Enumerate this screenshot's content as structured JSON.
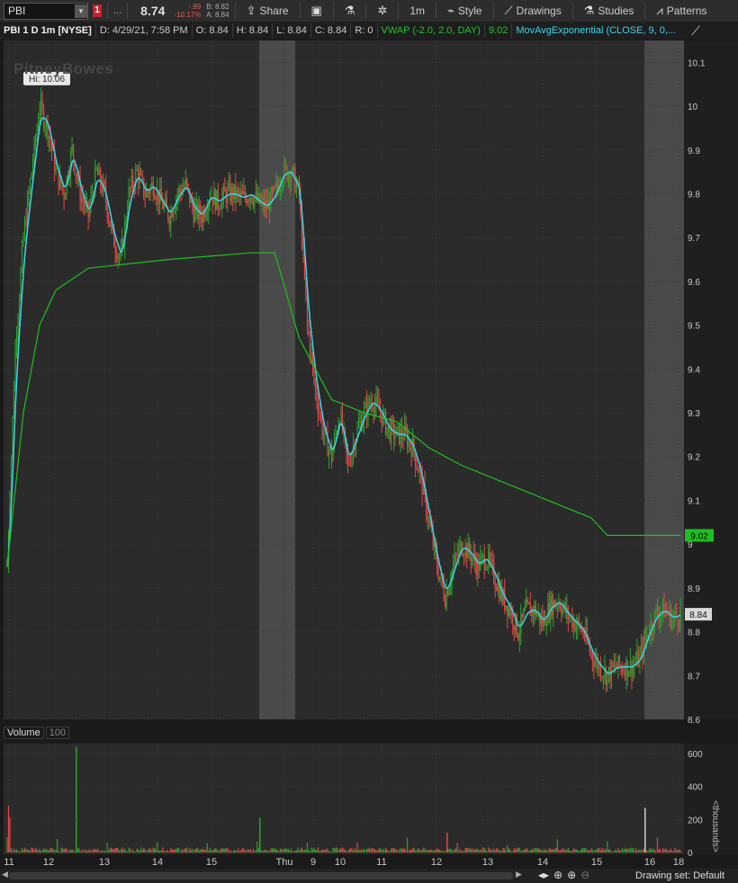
{
  "toolbar": {
    "symbol": "PBI",
    "alert_count": "1",
    "more": "...",
    "last": "8.74",
    "change": "-.99",
    "change_pct": "-10.17%",
    "bid": "B: 8.82",
    "ask": "A: 8.84",
    "share_label": "Share",
    "interval_label": "1m",
    "style_label": "Style",
    "drawings_label": "Drawings",
    "studies_label": "Studies",
    "patterns_label": "Patterns"
  },
  "info": {
    "title": "PBI 1 D 1m [NYSE]",
    "date": "D: 4/29/21, 7:58 PM",
    "open": "O: 8.84",
    "high": "H: 8.84",
    "low": "L: 8.84",
    "close": "C: 8.84",
    "range": "R: 0",
    "vwap_label": "VWAP (-2.0, 2.0, DAY)",
    "vwap_value": "9.02",
    "ema_label": "MovAvgExponential (CLOSE, 9, 0,..."
  },
  "watermark": "PitneyBowes",
  "volume": {
    "label": "Volume",
    "value": "100",
    "unit_label": "<thousands>"
  },
  "bottom": {
    "drawing_set": "Drawing set: Default"
  },
  "colors": {
    "up": "#2ea12e",
    "down": "#e04848",
    "vwap": "#1fbf1f",
    "ema": "#3ed4e8",
    "background": "#2b2b2b",
    "session_shade": "#4a4a4a"
  },
  "chart_data": {
    "type": "line",
    "price_axis": {
      "ticks": [
        8.6,
        8.7,
        8.8,
        8.9,
        9.0,
        9.1,
        9.2,
        9.3,
        9.4,
        9.5,
        9.6,
        9.7,
        9.8,
        9.9,
        10.0,
        10.1
      ],
      "ylim": [
        8.6,
        10.15
      ]
    },
    "time_ticks": [
      "11",
      "12",
      "13",
      "14",
      "15",
      "Thu",
      "9",
      "10",
      "11",
      "12",
      "13",
      "14",
      "15",
      "16",
      "18"
    ],
    "high_label": "Hi: 10.06",
    "last_price_label": "8.84",
    "vwap_price_label": "9.02",
    "series": [
      {
        "name": "PBI",
        "x": [
          0,
          1,
          2,
          3,
          4,
          5,
          6,
          7,
          8,
          9,
          10,
          11,
          12,
          13,
          14,
          15,
          16,
          17,
          18,
          19,
          20,
          21,
          22,
          23,
          24,
          25,
          26,
          27,
          28,
          29,
          30,
          31,
          32,
          33,
          34,
          35,
          36,
          37,
          38,
          39,
          40,
          41,
          42,
          43,
          44,
          45,
          46,
          47,
          48,
          49,
          50,
          51,
          52,
          53,
          54,
          55,
          56,
          57,
          58,
          59,
          60,
          61,
          62,
          63,
          64,
          65,
          66,
          67,
          68,
          69,
          70,
          71,
          72,
          73,
          74,
          75,
          76,
          77,
          78,
          79,
          80,
          81,
          82,
          83
        ],
        "values": [
          8.95,
          9.45,
          9.7,
          9.85,
          10.0,
          9.95,
          9.85,
          9.8,
          9.9,
          9.8,
          9.75,
          9.85,
          9.8,
          9.7,
          9.65,
          9.8,
          9.85,
          9.8,
          9.82,
          9.78,
          9.75,
          9.8,
          9.82,
          9.76,
          9.75,
          9.8,
          9.78,
          9.8,
          9.8,
          9.79,
          9.8,
          9.78,
          9.77,
          9.8,
          9.85,
          9.85,
          9.8,
          9.5,
          9.35,
          9.25,
          9.2,
          9.3,
          9.18,
          9.25,
          9.3,
          9.33,
          9.3,
          9.26,
          9.25,
          9.25,
          9.22,
          9.15,
          9.05,
          8.95,
          8.88,
          8.95,
          9.0,
          8.98,
          8.95,
          8.97,
          8.93,
          8.88,
          8.85,
          8.8,
          8.85,
          8.85,
          8.82,
          8.86,
          8.87,
          8.84,
          8.82,
          8.8,
          8.75,
          8.72,
          8.7,
          8.72,
          8.72,
          8.72,
          8.74,
          8.8,
          8.84,
          8.85,
          8.83,
          8.84
        ]
      },
      {
        "name": "VWAP",
        "x": [
          0,
          2,
          4,
          6,
          10,
          20,
          30,
          33,
          36,
          40,
          44,
          48,
          52,
          56,
          60,
          64,
          68,
          72,
          74,
          83
        ],
        "values": [
          8.95,
          9.3,
          9.5,
          9.58,
          9.63,
          9.65,
          9.665,
          9.665,
          9.47,
          9.33,
          9.3,
          9.28,
          9.22,
          9.18,
          9.15,
          9.12,
          9.09,
          9.06,
          9.02,
          9.02
        ]
      }
    ],
    "volume_axis": {
      "ticks": [
        0,
        200,
        400,
        600
      ],
      "ylim": [
        0,
        660
      ]
    }
  }
}
